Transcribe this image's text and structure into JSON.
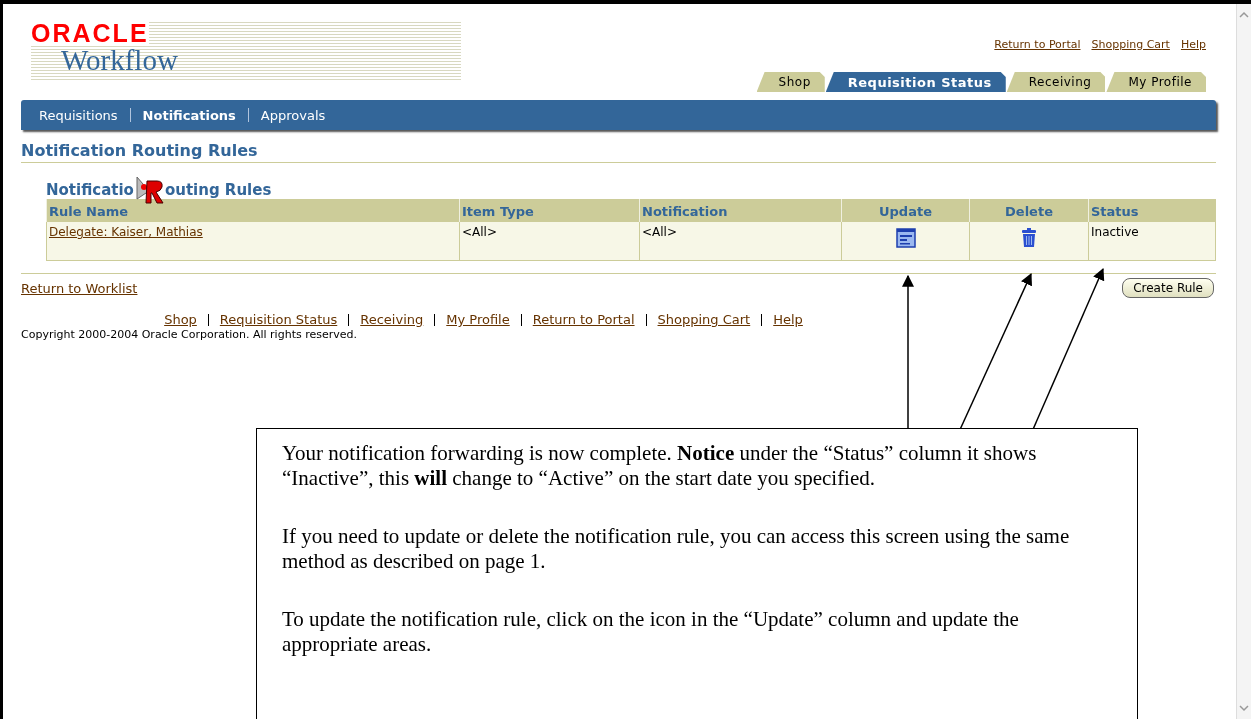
{
  "branding": {
    "vendor": "ORACLE",
    "product": "Workflow"
  },
  "global_links": [
    "Return to Portal",
    "Shopping Cart",
    "Help"
  ],
  "tabs": [
    {
      "label": "Shop",
      "selected": false
    },
    {
      "label": "Requisition Status",
      "selected": true
    },
    {
      "label": "Receiving",
      "selected": false
    },
    {
      "label": "My Profile",
      "selected": false
    }
  ],
  "subnav": [
    {
      "label": "Requisitions",
      "selected": false
    },
    {
      "label": "Notifications",
      "selected": true
    },
    {
      "label": "Approvals",
      "selected": false
    }
  ],
  "page_title": "Notification Routing Rules",
  "section": {
    "heading_parts": [
      "Notificatio",
      "outing Rules"
    ]
  },
  "table": {
    "columns": [
      {
        "label": "Rule Name",
        "kind": "text"
      },
      {
        "label": "Item Type",
        "kind": "text"
      },
      {
        "label": "Notification",
        "kind": "text"
      },
      {
        "label": "Update",
        "kind": "action"
      },
      {
        "label": "Delete",
        "kind": "action"
      },
      {
        "label": "Status",
        "kind": "text"
      }
    ],
    "rows": [
      {
        "cells": [
          {
            "kind": "link",
            "text": "Delegate: Kaiser, Mathias"
          },
          {
            "kind": "text",
            "text": "<All>"
          },
          {
            "kind": "text",
            "text": "<All>"
          },
          {
            "kind": "update"
          },
          {
            "kind": "delete"
          },
          {
            "kind": "text",
            "text": "Inactive"
          }
        ]
      }
    ]
  },
  "return_link": "Return to Worklist",
  "create_button": "Create Rule",
  "footer_links": [
    "Shop",
    "Requisition Status",
    "Receiving",
    "My Profile",
    "Return to Portal",
    "Shopping Cart",
    "Help"
  ],
  "copyright": "Copyright 2000-2004 Oracle Corporation. All rights reserved.",
  "callout": {
    "paragraphs": [
      "Your notification forwarding is now complete. **Notice** under the “Status” column it shows “Inactive”, this **will** change to “Active” on the start date you specified.",
      "If you need to update or delete the notification rule, you can access this screen using the same method as described on page 1.",
      "To update the notification rule, click on the icon in the “Update” column and update the appropriate areas."
    ]
  }
}
